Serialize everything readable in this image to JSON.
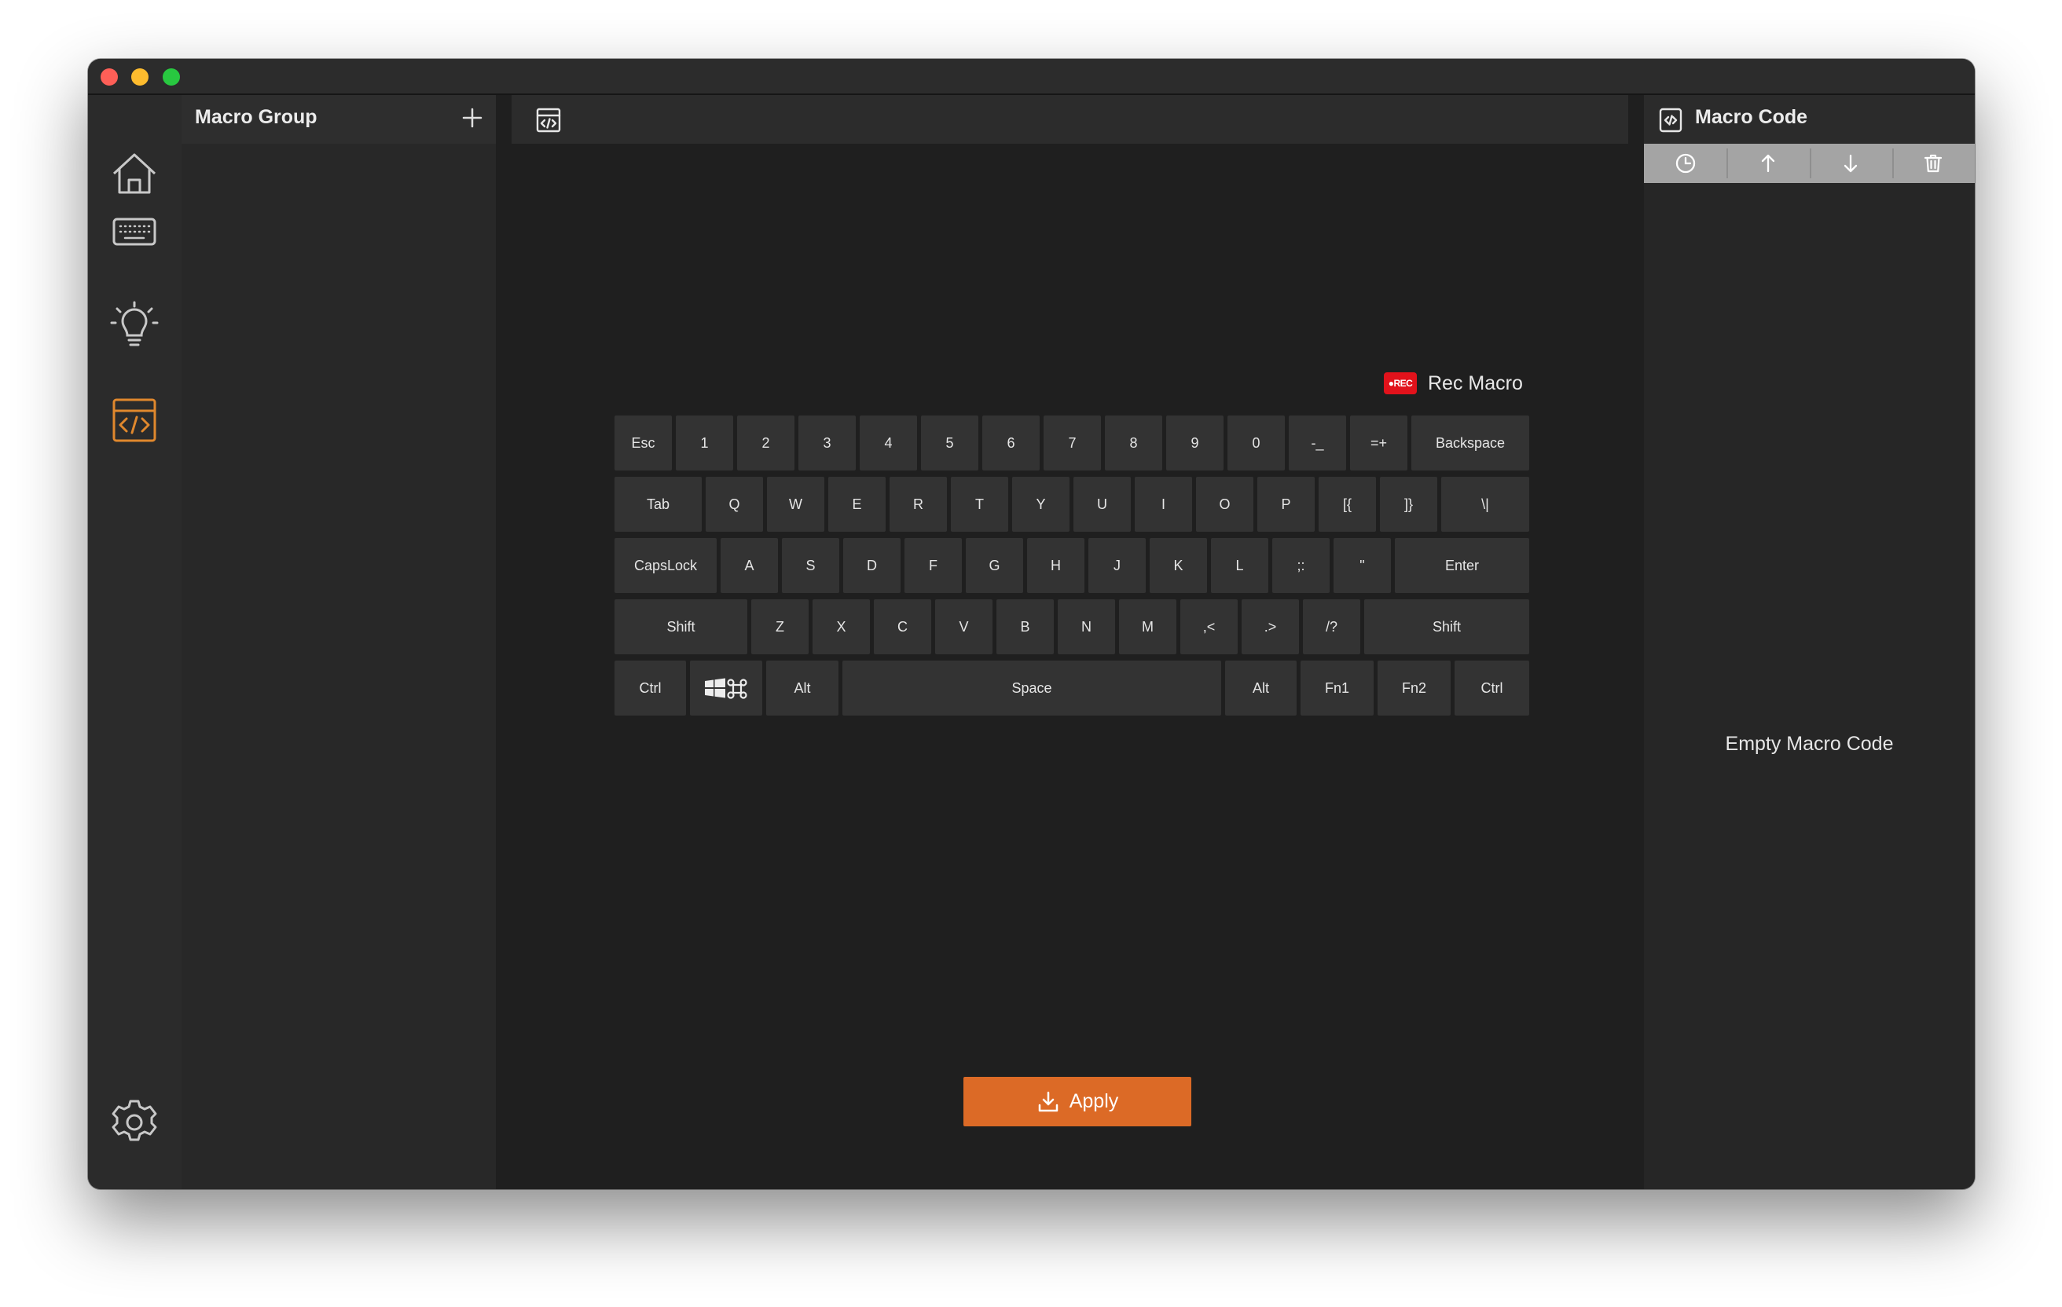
{
  "window": {
    "controls": [
      "close",
      "minimize",
      "zoom"
    ]
  },
  "sidebar": {
    "items": [
      {
        "name": "home-icon",
        "active": false
      },
      {
        "name": "keyboard-icon",
        "active": false
      },
      {
        "name": "lighting-bulb-icon",
        "active": false
      },
      {
        "name": "macro-code-icon",
        "active": true
      },
      {
        "name": "gear-icon",
        "active": false
      }
    ],
    "active_color": "#e0882d",
    "icon_color": "#c8c8c8"
  },
  "group_panel": {
    "title": "Macro Group",
    "add_icon": "plus-icon"
  },
  "editor": {
    "header_icon": "code-window-icon",
    "rec": {
      "badge": "●REC",
      "label": "Rec Macro"
    },
    "keyboard": {
      "rows": [
        [
          "Esc",
          "1",
          "2",
          "3",
          "4",
          "5",
          "6",
          "7",
          "8",
          "9",
          "0",
          "-_",
          "=+",
          "Backspace"
        ],
        [
          "Tab",
          "Q",
          "W",
          "E",
          "R",
          "T",
          "Y",
          "U",
          "I",
          "O",
          "P",
          "[{",
          "]}",
          "\\|"
        ],
        [
          "CapsLock",
          "A",
          "S",
          "D",
          "F",
          "G",
          "H",
          "J",
          "K",
          "L",
          ";:",
          "\"",
          "Enter"
        ],
        [
          "Shift",
          "Z",
          "X",
          "C",
          "V",
          "B",
          "N",
          "M",
          ",<",
          ".>",
          "/?",
          "Shift"
        ],
        [
          "Ctrl",
          "",
          "Alt",
          "Space",
          "Alt",
          "Fn1",
          "Fn2",
          "Ctrl"
        ]
      ],
      "win_cmd_key_icon": "windows-command-icon"
    },
    "apply": {
      "label": "Apply",
      "icon": "download-icon",
      "color": "#dc6a26"
    }
  },
  "code_panel": {
    "title": "Macro Code",
    "toolbar": [
      {
        "name": "clock-icon"
      },
      {
        "name": "arrow-up-icon"
      },
      {
        "name": "arrow-down-icon"
      },
      {
        "name": "trash-icon"
      }
    ],
    "empty_text": "Empty Macro Code"
  }
}
